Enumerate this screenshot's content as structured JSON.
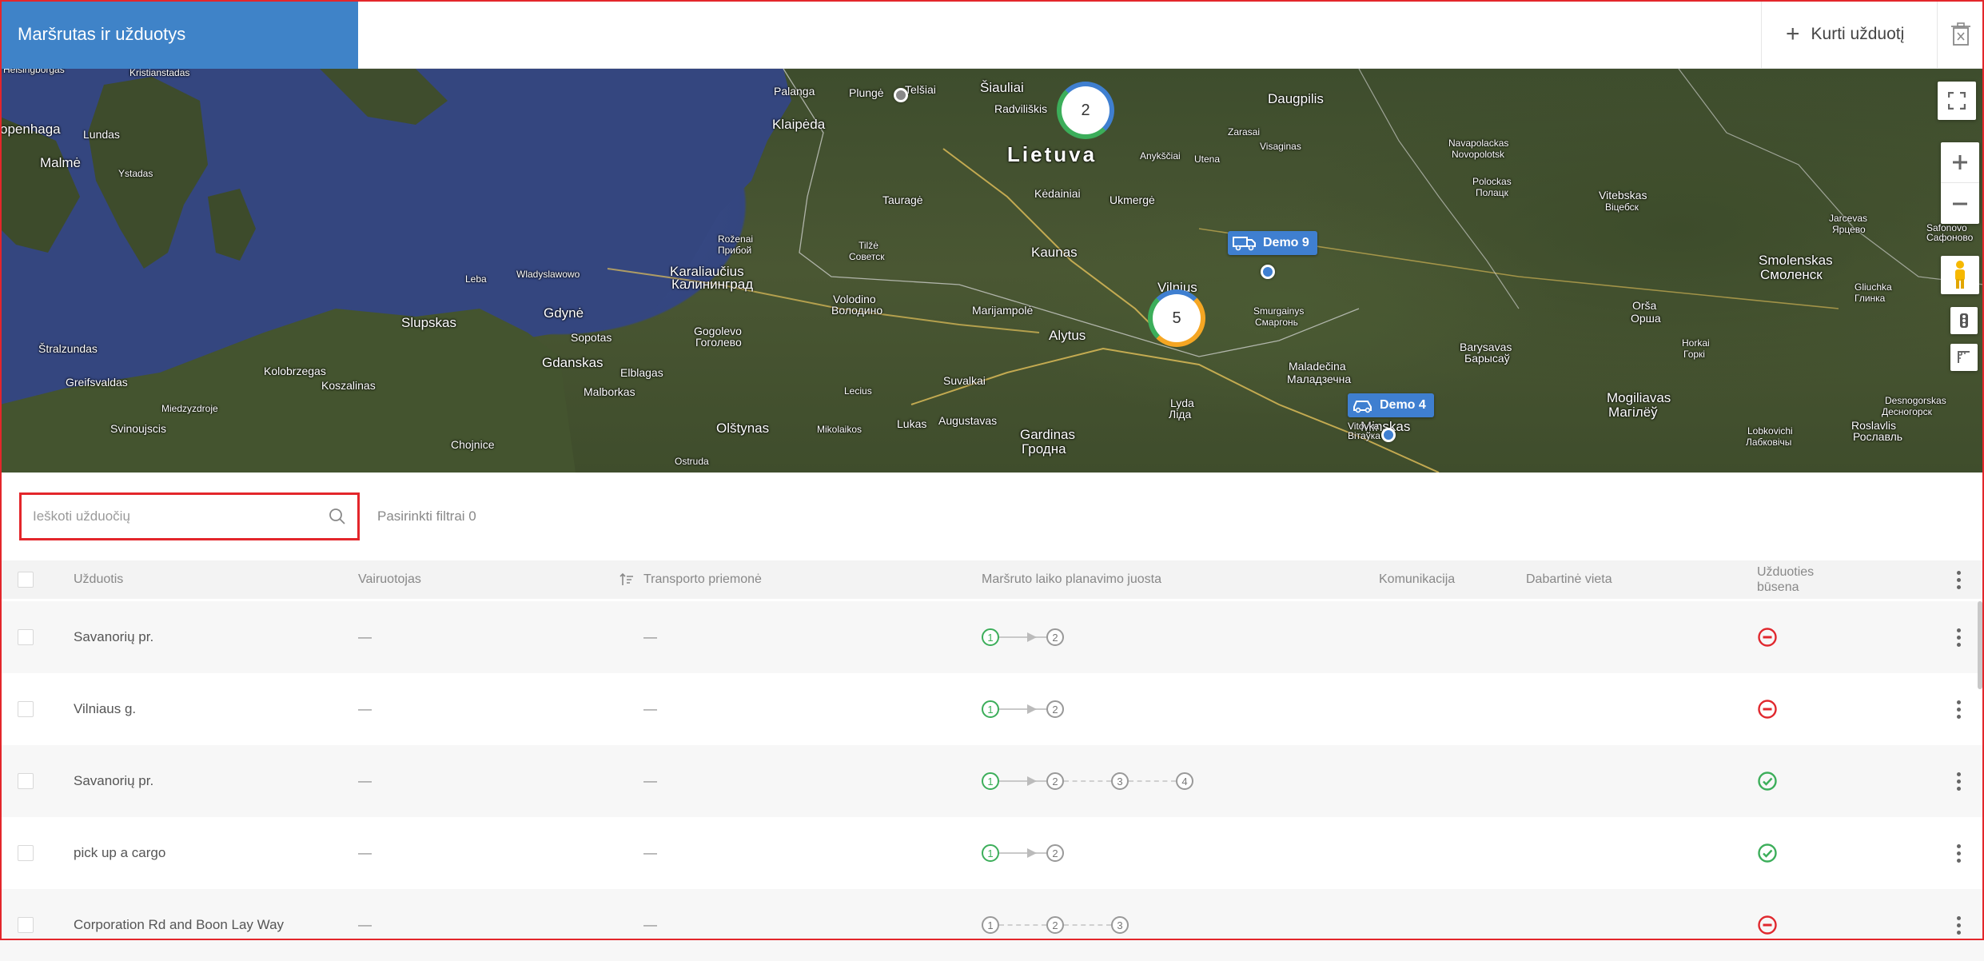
{
  "header": {
    "title": "Maršrutas ir užduotys",
    "create_label": "Kurti užduotį",
    "create_icon": "plus-icon",
    "delete_icon": "trash-icon"
  },
  "map": {
    "country_label": "Lietuva",
    "cities": [
      "Helsingborgas",
      "Kristianstadas",
      "openhaga",
      "Lundas",
      "Malmė",
      "Ystadas",
      "Palanga",
      "Plungė",
      "Telšiai",
      "Šiauliai",
      "Radviliškis",
      "Daugpilis",
      "Klaipėda",
      "Anykščiai",
      "Utena",
      "Zarasai",
      "Visaginas",
      "Navapolackas",
      "Novopolotsk",
      "Polockas",
      "Полацк",
      "Vitebskas",
      "Віцебск",
      "Jarcevas",
      "Ярцево",
      "Safonovo",
      "Сафоново",
      "Tauragė",
      "Kėdainiai",
      "Ukmergė",
      "Smolenskas",
      "Смоленск",
      "Gliuchka",
      "Глинка",
      "Roženai",
      "Прибой",
      "Tilžė",
      "Советск",
      "Kaunas",
      "Vilnius",
      "Karaliaučius",
      "Калининград",
      "Volodino",
      "Володино",
      "Marijampolė",
      "Smurgainys",
      "Смаргонь",
      "Orša",
      "Орша",
      "Leba",
      "Wladyslawowo",
      "Gdynė",
      "Slupskas",
      "Sopotas",
      "Gogolevo",
      "Гоголево",
      "Alytus",
      "Barysavas",
      "Барысаў",
      "Horkai",
      "Горкі",
      "Štralzundas",
      "Gdanskas",
      "Elblagas",
      "Kolobrzegas",
      "Koszalinas",
      "Greifsvaldas",
      "Malborkas",
      "Lecius",
      "Suvalkai",
      "Maladečina",
      "Маладзечна",
      "Mogiliavas",
      "Магілёў",
      "Desnogorskas",
      "Десногорск",
      "Miedzyzdroje",
      "Svinoujscis",
      "Lukas",
      "Augustavas",
      "Gardinas",
      "Гродна",
      "Lyda",
      "Ліда",
      "Minskas",
      "Vitovka",
      "Вітаўка",
      "Roslavlis",
      "Рославль",
      "Lobkovichi",
      "Лабковічы",
      "Chojnice",
      "Olštynas",
      "Mikolaikos",
      "Ostruda"
    ],
    "clusters": [
      {
        "count": "2"
      },
      {
        "count": "5"
      }
    ],
    "vehicles": [
      {
        "name": "Demo 9",
        "icon": "truck-icon"
      },
      {
        "name": "Demo 4",
        "icon": "car-icon"
      }
    ],
    "controls": [
      "fullscreen-icon",
      "zoom-in-icon",
      "zoom-out-icon",
      "pegman-icon",
      "traffic-icon",
      "ruler-icon"
    ]
  },
  "filters": {
    "search_placeholder": "Ieškoti užduočių",
    "search_icon": "search-icon",
    "selected_label": "Pasirinkti filtrai 0"
  },
  "table": {
    "columns": {
      "task": "Užduotis",
      "driver": "Vairuotojas",
      "vehicle": "Transporto priemonė",
      "timeline": "Maršruto laiko planavimo juosta",
      "communication": "Komunikacija",
      "location": "Dabartinė vieta",
      "status_line1": "Užduoties",
      "status_line2": "būsena"
    },
    "rows": [
      {
        "task": "Savanorių pr.",
        "driver": "—",
        "vehicle": "—",
        "stops": [
          "1",
          "2"
        ],
        "done_stops": 1,
        "status": "cancelled",
        "status_icon": "minus-circle-icon"
      },
      {
        "task": "Vilniaus g.",
        "driver": "—",
        "vehicle": "—",
        "stops": [
          "1",
          "2"
        ],
        "done_stops": 1,
        "status": "cancelled",
        "status_icon": "minus-circle-icon"
      },
      {
        "task": "Savanorių pr.",
        "driver": "—",
        "vehicle": "—",
        "stops": [
          "1",
          "2",
          "3",
          "4"
        ],
        "done_stops": 1,
        "status": "completed",
        "status_icon": "check-circle-icon"
      },
      {
        "task": "pick up a cargo",
        "driver": "—",
        "vehicle": "—",
        "stops": [
          "1",
          "2"
        ],
        "done_stops": 1,
        "status": "completed",
        "status_icon": "check-circle-icon"
      },
      {
        "task": "Corporation Rd and Boon Lay Way",
        "driver": "—",
        "vehicle": "—",
        "stops": [
          "1",
          "2",
          "3"
        ],
        "done_stops": 0,
        "status": "cancelled",
        "status_icon": "minus-circle-icon"
      }
    ]
  },
  "colors": {
    "accent": "#3f83c8",
    "highlight": "#e3262b",
    "done": "#3cae5a",
    "cancel": "#e0282e"
  }
}
